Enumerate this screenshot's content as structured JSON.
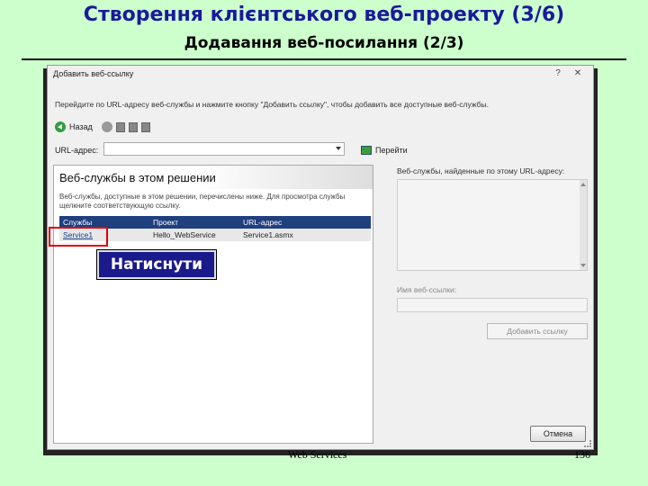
{
  "slide": {
    "title": "Створення клієнтського веб-проекту (3/6)",
    "subtitle": "Додавання веб-посилання (2/3)",
    "footer": "Web Services",
    "page_number": "136"
  },
  "dialog": {
    "title": "Добавить веб-ссылку",
    "help": "?",
    "close": "✕",
    "instruction": "Перейдите по URL-адресу веб-службы и нажмите кнопку \"Добавить ссылку\", чтобы добавить все доступные веб-службы.",
    "toolbar": {
      "back_label": "Назад"
    },
    "url": {
      "label": "URL-адрес:",
      "value": ""
    },
    "go_label": "Перейти",
    "left_pane": {
      "heading": "Веб-службы в этом решении",
      "description": "Веб-службы, доступные в этом решении, перечислены ниже. Для просмотра службы щелкните соответствующую ссылку.",
      "columns": [
        "Службы",
        "Проект",
        "URL-адрес"
      ],
      "rows": [
        {
          "service": "Service1",
          "project": "Hello_WebService",
          "url": "Service1.asmx"
        }
      ]
    },
    "right_pane": {
      "found_label": "Веб-службы, найденные по этому URL-адресу:",
      "name_label": "Имя веб-ссылки:",
      "name_value": "",
      "add_button": "Добавить ссылку"
    },
    "cancel_button": "Отмена"
  },
  "callout": {
    "text": "Натиснути"
  },
  "colors": {
    "background": "#ccffcc",
    "title": "#1a1a9a",
    "callout_bg": "#1a1a8c",
    "highlight": "#e00000",
    "table_header": "#1f3f7f"
  }
}
